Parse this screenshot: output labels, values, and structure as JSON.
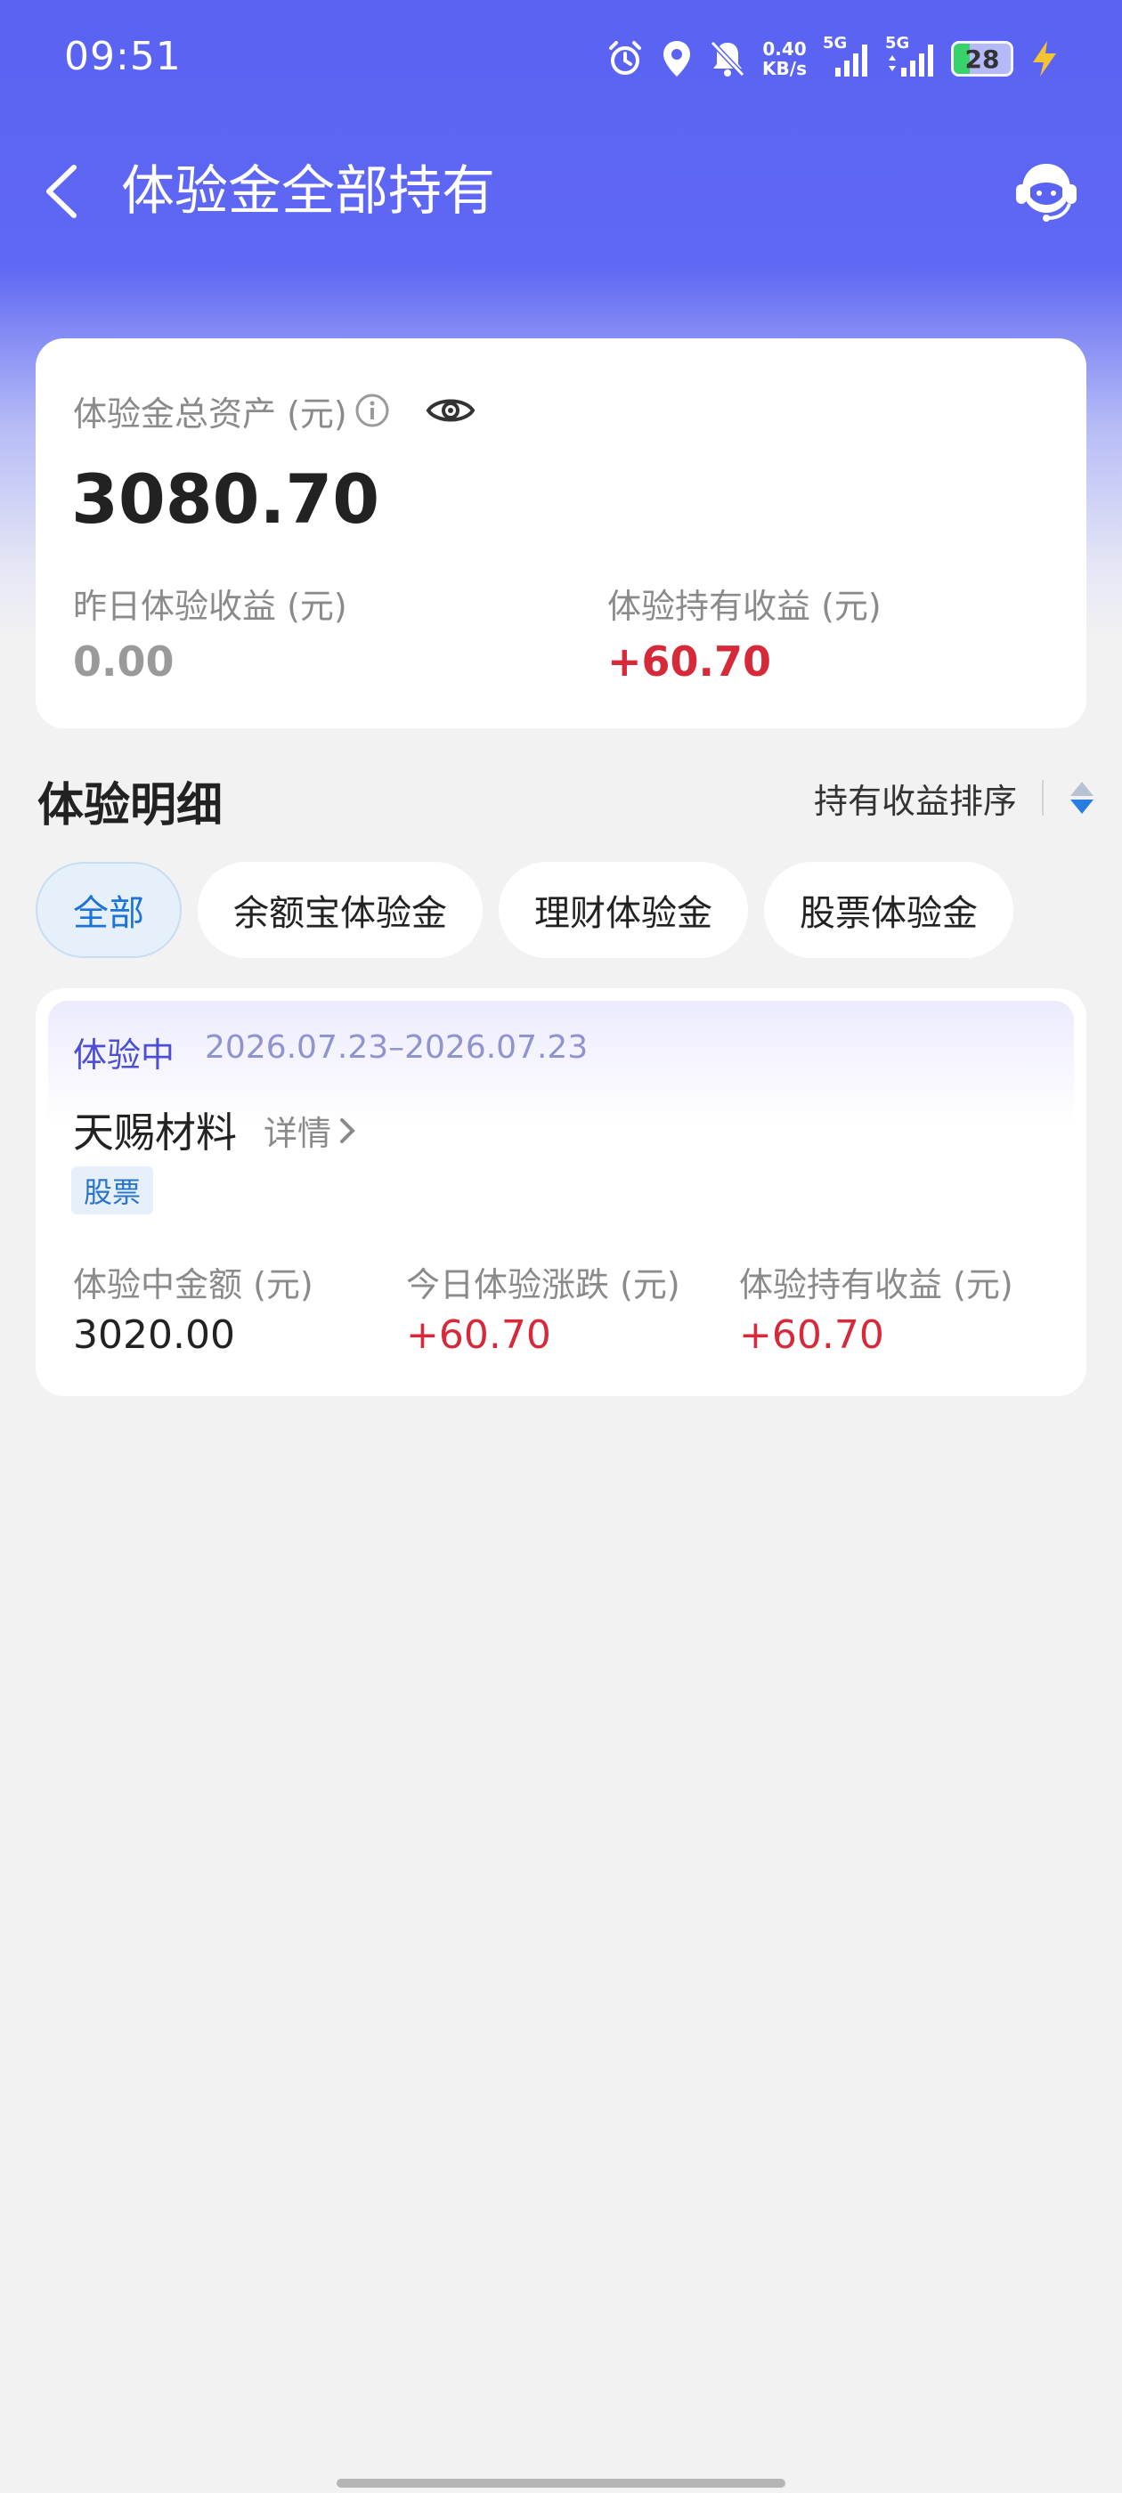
{
  "status_bar": {
    "time": "09:51",
    "net_speed_value": "0.40",
    "net_speed_unit": "KB/s",
    "signal1_label": "5G",
    "signal2_label": "5G",
    "battery": "28",
    "battery_fraction": 0.28,
    "icons": [
      "alarm-icon",
      "location-icon",
      "mute-icon",
      "signal-icon",
      "battery-icon",
      "charging-icon"
    ]
  },
  "nav": {
    "title": "体验金全部持有",
    "icons": [
      "back-icon",
      "customer-service-icon"
    ]
  },
  "asset_card": {
    "label": "体验金总资产 (元)",
    "total": "3080.70",
    "yesterday_label": "昨日体验收益 (元)",
    "yesterday_value": "0.00",
    "holding_label": "体验持有收益 (元)",
    "holding_value": "+60.70",
    "icons": [
      "info-icon",
      "eye-icon"
    ]
  },
  "details": {
    "title": "体验明细",
    "sort_label": "持有收益排序",
    "filters": [
      "全部",
      "余额宝体验金",
      "理财体验金",
      "股票体验金"
    ],
    "active_filter_index": 0
  },
  "holding": {
    "status": "体验中",
    "date_range": "2026.07.23–2026.07.23",
    "name": "天赐材料",
    "detail_link": "详情",
    "tag": "股票",
    "columns": [
      {
        "label": "体验中金额 (元)",
        "value": "3020.00"
      },
      {
        "label": "今日体验涨跌 (元)",
        "value": "+60.70"
      },
      {
        "label": "体验持有收益 (元)",
        "value": "+60.70"
      }
    ]
  },
  "colors": {
    "brand": "#5a63f2",
    "profit_red": "#d62a3a",
    "active_chip": "#1d74d6"
  }
}
